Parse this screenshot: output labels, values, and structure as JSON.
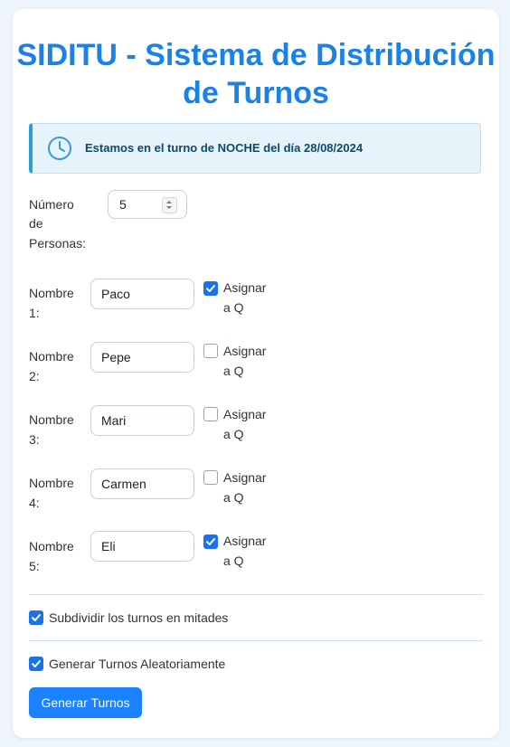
{
  "title": "SIDITU - Sistema de Distribución de Turnos",
  "alert": {
    "icon": "clock-icon",
    "message": "Estamos en el turno de NOCHE del día 28/08/2024"
  },
  "num_personas": {
    "label_lines": [
      "Número",
      "de",
      "Personas:"
    ],
    "value": "5"
  },
  "personas": [
    {
      "label_top": "Nombre",
      "label_num": "1:",
      "value": "Paco",
      "assign_q": true
    },
    {
      "label_top": "Nombre",
      "label_num": "2:",
      "value": "Pepe",
      "assign_q": false
    },
    {
      "label_top": "Nombre",
      "label_num": "3:",
      "value": "Mari",
      "assign_q": false
    },
    {
      "label_top": "Nombre",
      "label_num": "4:",
      "value": "Carmen",
      "assign_q": false
    },
    {
      "label_top": "Nombre",
      "label_num": "5:",
      "value": "Eli",
      "assign_q": true
    }
  ],
  "assign_label_lines": [
    "Asignar",
    "a Q"
  ],
  "options": {
    "subdividir": {
      "label": "Subdividir los turnos en mitades",
      "checked": true
    },
    "aleatorio": {
      "label": "Generar Turnos Aleatoriamente",
      "checked": true
    }
  },
  "button": {
    "label": "Generar Turnos"
  },
  "colors": {
    "title": "#1a82e6",
    "accent": "#1a73e8",
    "button": "#1a82ff",
    "alert_bg": "#e6f3fb"
  }
}
